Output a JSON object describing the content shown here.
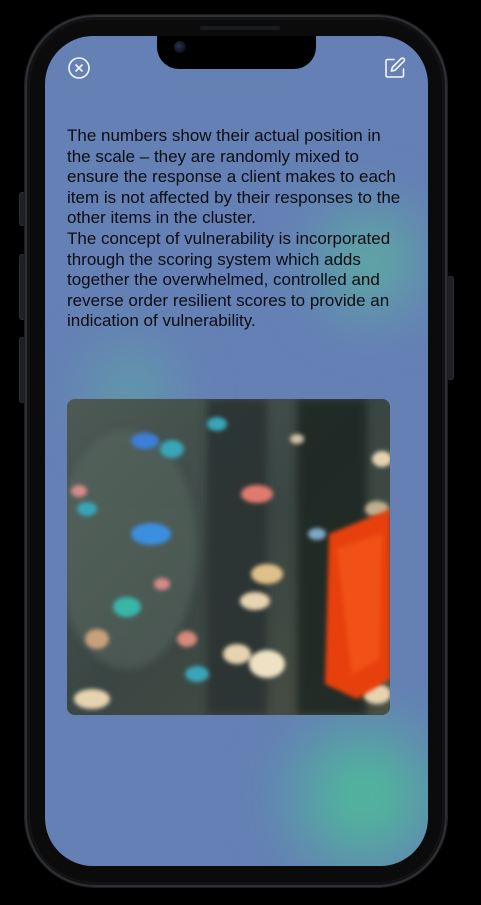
{
  "screen": {
    "background": "#6580b5",
    "accent_glow": "#46cd91"
  },
  "toolbar": {
    "close_icon": "close-circle-icon",
    "edit_icon": "edit-icon"
  },
  "content": {
    "paragraph_1": "The numbers show their actual position in the scale – they are randomly mixed to ensure the response a client makes to each item is not affected by their responses to the other items in the cluster.",
    "paragraph_2": "The concept of vulnerability is incorporated through the scoring system which adds together the overwhelmed, controlled and reverse order resilient scores to provide an indication of vulnerability."
  },
  "image": {
    "colors": {
      "base": "#3b4a4d",
      "orange": "#e8410f",
      "cyan": "#39a6b8",
      "blue": "#3a7fd9",
      "pink": "#d98a8a",
      "cream": "#e6d3b0",
      "dark": "#1a2224"
    }
  }
}
